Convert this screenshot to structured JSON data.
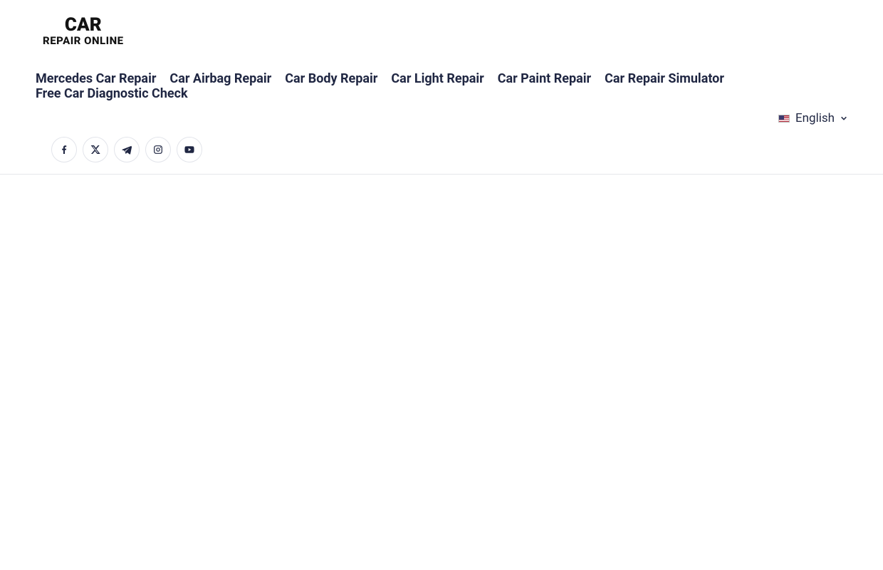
{
  "logo": {
    "line1": "CAR",
    "line2": "REPAIR ONLINE"
  },
  "nav": {
    "items": [
      "Mercedes Car Repair",
      "Car Airbag Repair",
      "Car Body Repair",
      "Car Light Repair",
      "Car Paint Repair",
      "Car Repair Simulator",
      "Free Car Diagnostic Check"
    ]
  },
  "language": {
    "current": "English"
  },
  "social": {
    "items": [
      {
        "name": "facebook"
      },
      {
        "name": "x-twitter"
      },
      {
        "name": "telegram"
      },
      {
        "name": "instagram"
      },
      {
        "name": "youtube"
      }
    ]
  }
}
